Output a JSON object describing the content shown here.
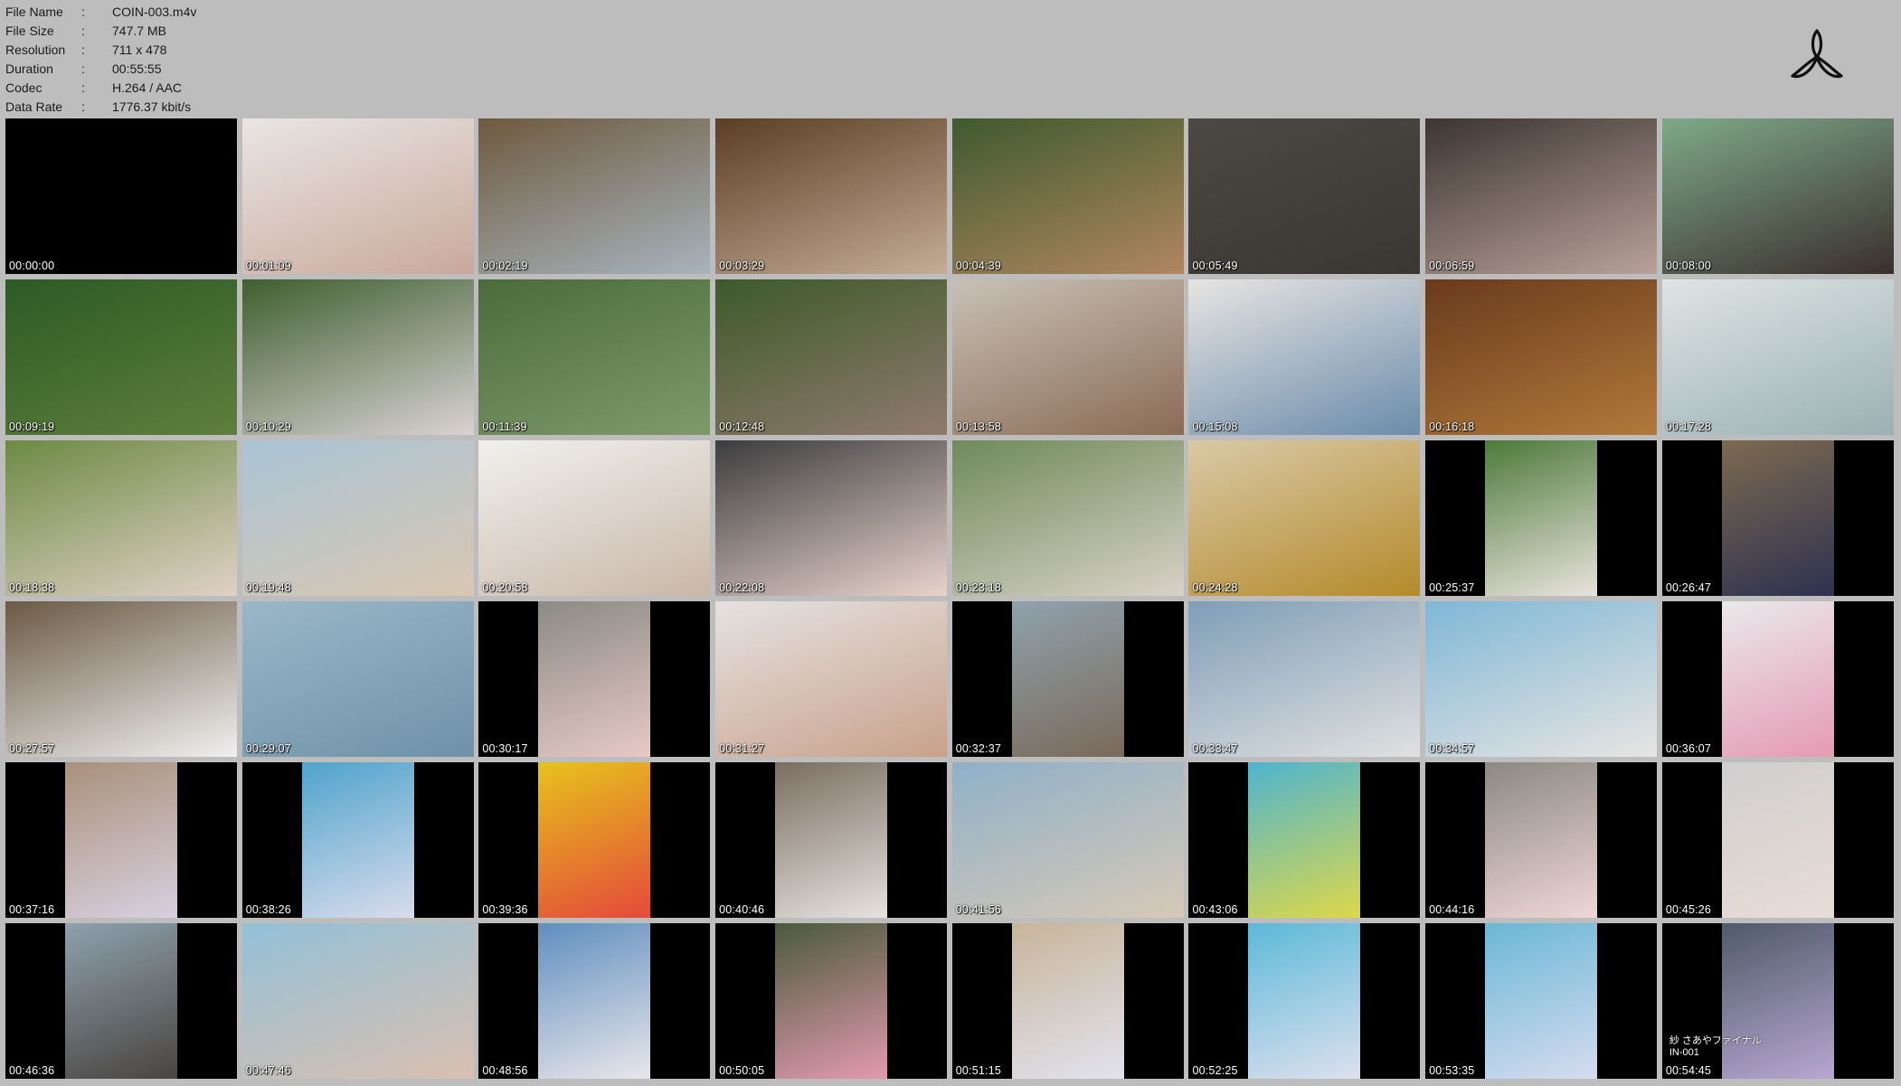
{
  "info": [
    {
      "label": "File Name",
      "sep": ":",
      "value": "COIN-003.m4v"
    },
    {
      "label": "File Size",
      "sep": ":",
      "value": "747.7 MB"
    },
    {
      "label": "Resolution",
      "sep": ":",
      "value": "711 x 478"
    },
    {
      "label": "Duration",
      "sep": ":",
      "value": "00:55:55"
    },
    {
      "label": "Codec",
      "sep": ":",
      "value": "H.264 / AAC"
    },
    {
      "label": "Data Rate",
      "sep": ":",
      "value": "1776.37 kbit/s"
    }
  ],
  "logo_icon": "three-blade-propeller-icon",
  "thumbnails": [
    {
      "time": "00:00:00",
      "layout": "empty",
      "colors": [
        "#000000",
        "#000000"
      ]
    },
    {
      "time": "00:01:09",
      "layout": "full",
      "colors": [
        "#e9e5e4",
        "#c9a99b"
      ]
    },
    {
      "time": "00:02:19",
      "layout": "full",
      "colors": [
        "#6e5a3e",
        "#a7b3bd"
      ]
    },
    {
      "time": "00:03:29",
      "layout": "full",
      "colors": [
        "#5a3f25",
        "#c5ac96"
      ]
    },
    {
      "time": "00:04:39",
      "layout": "full",
      "colors": [
        "#3f5a2e",
        "#b08660"
      ]
    },
    {
      "time": "00:05:49",
      "layout": "full",
      "colors": [
        "#4c4844",
        "#3a3632"
      ]
    },
    {
      "time": "00:06:59",
      "layout": "full",
      "colors": [
        "#3c3530",
        "#b9a19a"
      ]
    },
    {
      "time": "00:08:00",
      "layout": "full",
      "colors": [
        "#7fa98a",
        "#3a2f2c"
      ]
    },
    {
      "time": "00:09:19",
      "layout": "full",
      "colors": [
        "#2d5a25",
        "#5e7f3c"
      ]
    },
    {
      "time": "00:10:29",
      "layout": "full",
      "colors": [
        "#3f5f2f",
        "#d9d2d3"
      ]
    },
    {
      "time": "00:11:39",
      "layout": "full",
      "colors": [
        "#4a6c3a",
        "#7f9a6a"
      ]
    },
    {
      "time": "00:12:48",
      "layout": "full",
      "colors": [
        "#3d5a2a",
        "#8f7a6e"
      ]
    },
    {
      "time": "00:13:58",
      "layout": "full",
      "colors": [
        "#c8c0b6",
        "#8a6c55"
      ]
    },
    {
      "time": "00:15:08",
      "layout": "full",
      "colors": [
        "#e7e4e2",
        "#6b8cab"
      ]
    },
    {
      "time": "00:16:18",
      "layout": "full",
      "colors": [
        "#6a3a1c",
        "#b07a3a"
      ]
    },
    {
      "time": "00:17:28",
      "layout": "full",
      "colors": [
        "#dfe4e4",
        "#9ab0b3"
      ]
    },
    {
      "time": "00:18:38",
      "layout": "full",
      "colors": [
        "#6c8a43",
        "#e0d1c6"
      ]
    },
    {
      "time": "00:19:48",
      "layout": "full",
      "colors": [
        "#a9c4d6",
        "#d9c7b1"
      ]
    },
    {
      "time": "00:20:58",
      "layout": "full",
      "colors": [
        "#f0f0ee",
        "#c9b7a8"
      ]
    },
    {
      "time": "00:22:08",
      "layout": "full",
      "colors": [
        "#3c3c3e",
        "#e8d3cc"
      ]
    },
    {
      "time": "00:23:18",
      "layout": "full",
      "colors": [
        "#6f8a59",
        "#d8d2c8"
      ]
    },
    {
      "time": "00:24:28",
      "layout": "full",
      "colors": [
        "#d8c9a7",
        "#b58a2a"
      ]
    },
    {
      "time": "00:25:37",
      "layout": "portrait",
      "colors": [
        "#4d7a3a",
        "#e9e3dd"
      ]
    },
    {
      "time": "00:26:47",
      "layout": "portrait",
      "colors": [
        "#7c6a50",
        "#2e3150"
      ]
    },
    {
      "time": "00:27:57",
      "layout": "full",
      "colors": [
        "#6b5a44",
        "#f0f0f0"
      ]
    },
    {
      "time": "00:29:07",
      "layout": "full",
      "colors": [
        "#9ab7c8",
        "#6f92a8"
      ]
    },
    {
      "time": "00:30:17",
      "layout": "portrait",
      "colors": [
        "#8b8a84",
        "#e7c9c6"
      ]
    },
    {
      "time": "00:31:27",
      "layout": "full",
      "colors": [
        "#e5e2e1",
        "#c8a18b"
      ]
    },
    {
      "time": "00:32:37",
      "layout": "portrait",
      "colors": [
        "#8fa2ad",
        "#7a6a5a"
      ]
    },
    {
      "time": "00:33:47",
      "layout": "full",
      "colors": [
        "#7f9eb7",
        "#e0e0e0"
      ]
    },
    {
      "time": "00:34:57",
      "layout": "full",
      "colors": [
        "#7fb7d6",
        "#e7e5e2"
      ]
    },
    {
      "time": "00:36:07",
      "layout": "portrait",
      "colors": [
        "#e9e9ea",
        "#e59ab4"
      ]
    },
    {
      "time": "00:37:16",
      "layout": "portrait",
      "colors": [
        "#a9907a",
        "#d8d0e0"
      ]
    },
    {
      "time": "00:38:26",
      "layout": "portrait",
      "colors": [
        "#4fa3cc",
        "#d9dcec"
      ]
    },
    {
      "time": "00:39:36",
      "layout": "portrait",
      "colors": [
        "#e6c21c",
        "#e44a3a"
      ]
    },
    {
      "time": "00:40:46",
      "layout": "portrait",
      "colors": [
        "#7a6e60",
        "#e6e2df"
      ]
    },
    {
      "time": "00:41:56",
      "layout": "full",
      "colors": [
        "#8fb0c8",
        "#d6c9b7"
      ]
    },
    {
      "time": "00:43:06",
      "layout": "portrait",
      "colors": [
        "#4fb4cf",
        "#dcd84a"
      ]
    },
    {
      "time": "00:44:16",
      "layout": "portrait",
      "colors": [
        "#8b8882",
        "#efd7d6"
      ]
    },
    {
      "time": "00:45:26",
      "layout": "portrait",
      "colors": [
        "#cfcfcf",
        "#e9dcd6"
      ]
    },
    {
      "time": "00:46:36",
      "layout": "portrait",
      "colors": [
        "#8ea1ad",
        "#4a4440"
      ]
    },
    {
      "time": "00:47:46",
      "layout": "full",
      "colors": [
        "#93c0d8",
        "#d9c0b0"
      ]
    },
    {
      "time": "00:48:56",
      "layout": "portrait",
      "colors": [
        "#5f8fbf",
        "#e9e6ea"
      ]
    },
    {
      "time": "00:50:05",
      "layout": "portrait",
      "colors": [
        "#4a5a3a",
        "#e39ab0"
      ]
    },
    {
      "time": "00:51:15",
      "layout": "portrait",
      "colors": [
        "#c7b59a",
        "#e2e2ee"
      ]
    },
    {
      "time": "00:52:25",
      "layout": "portrait",
      "colors": [
        "#5cb9d8",
        "#dde0ee"
      ]
    },
    {
      "time": "00:53:35",
      "layout": "portrait",
      "colors": [
        "#6ab7d6",
        "#d6dcef"
      ]
    },
    {
      "time": "00:54:45",
      "layout": "portrait",
      "colors": [
        "#4f5a6a",
        "#b7a7d0"
      ],
      "overlay": [
        "紗 さあやファイナル",
        "IN-001"
      ]
    }
  ]
}
